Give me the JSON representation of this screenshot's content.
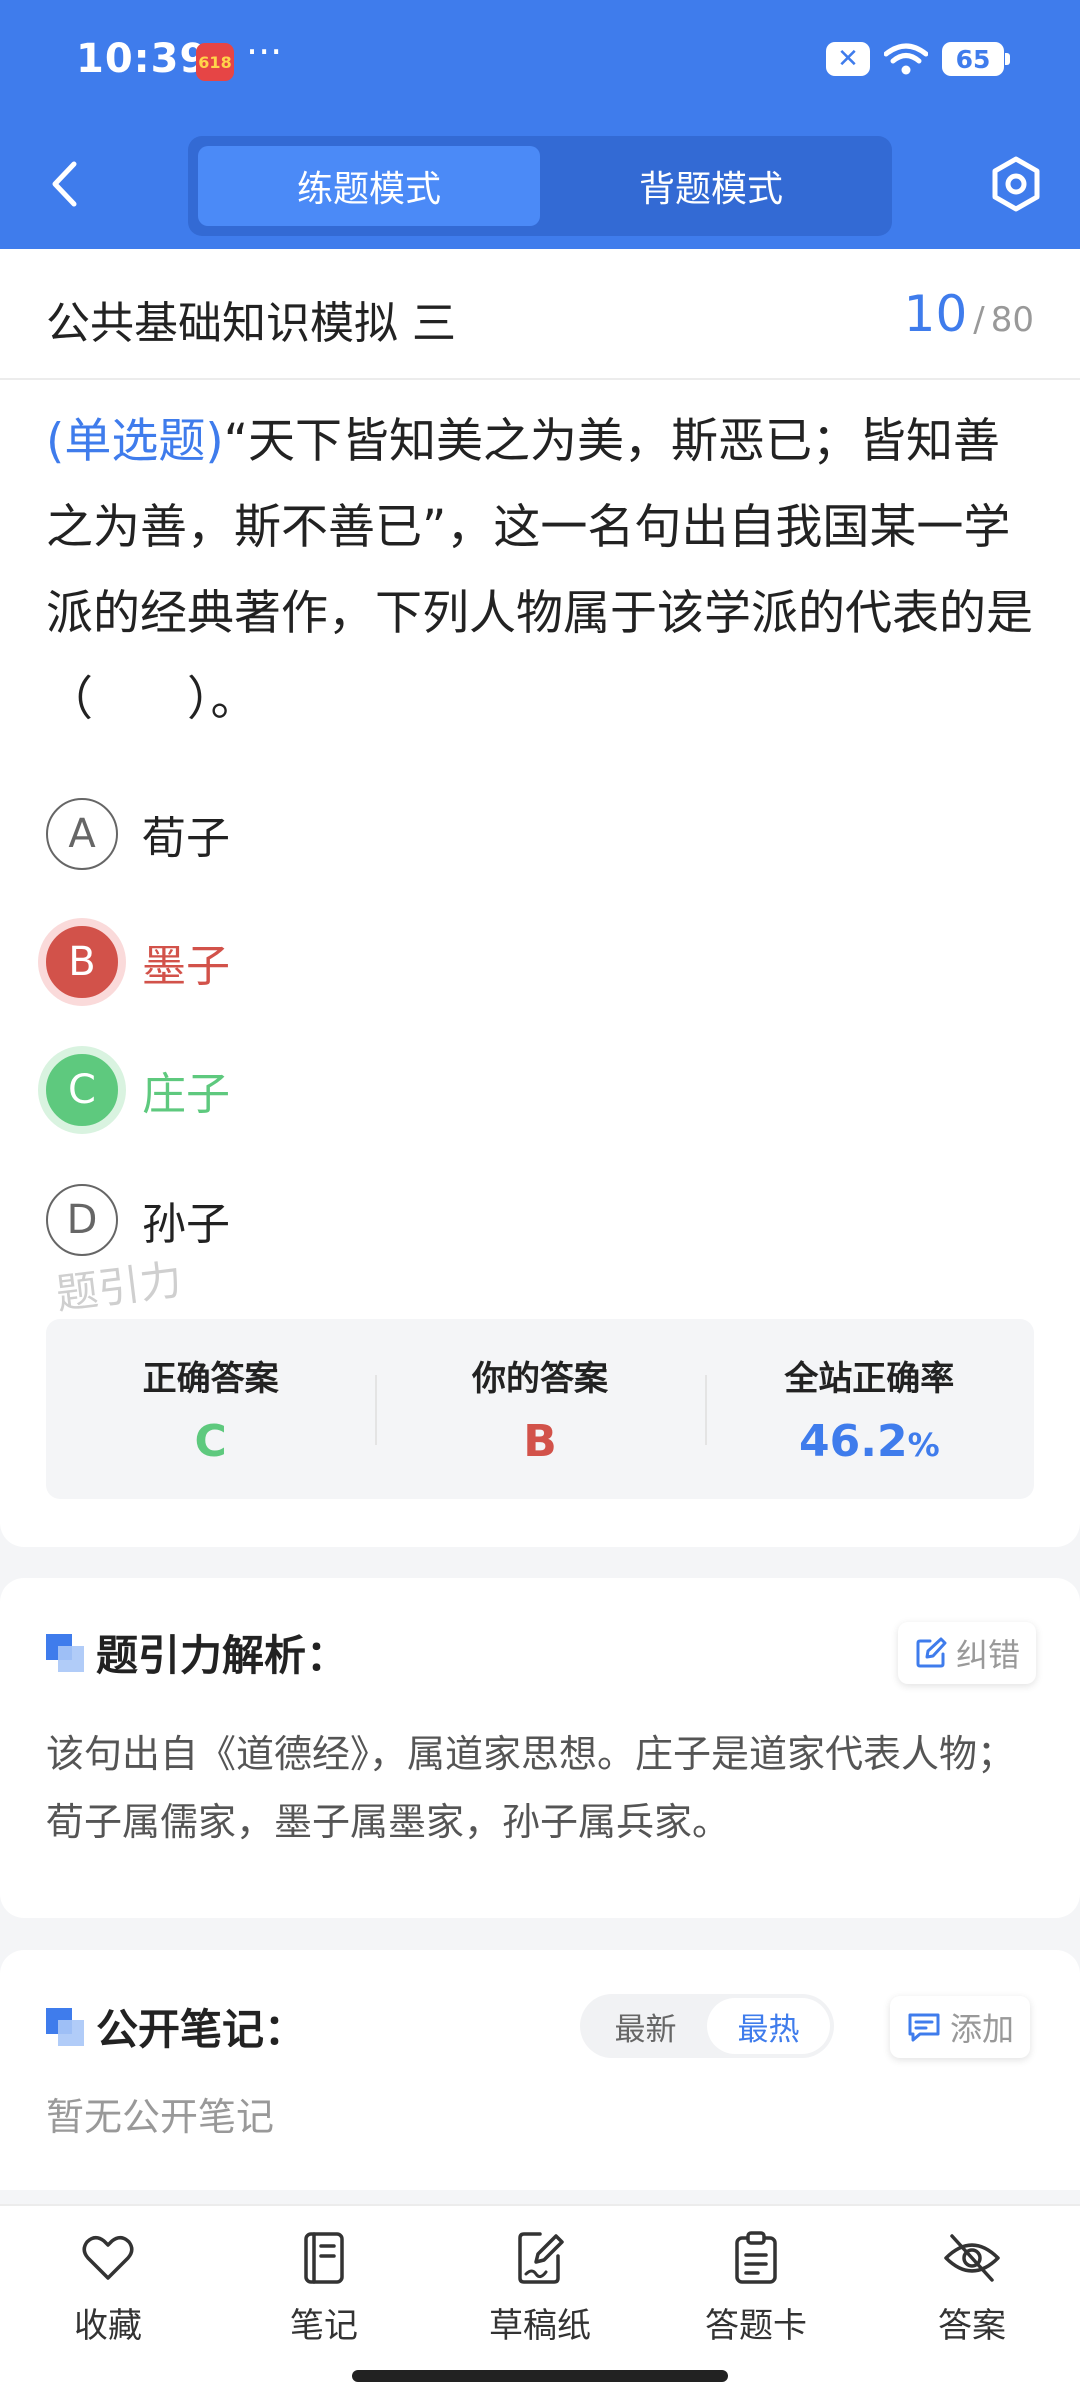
{
  "status": {
    "time": "10:39",
    "app_badge": "618",
    "dots": "···",
    "battery": "65"
  },
  "header": {
    "modes": [
      "练题模式",
      "背题模式"
    ],
    "active_mode": "练题模式"
  },
  "paper": {
    "title": "公共基础知识模拟 三",
    "current": "10",
    "separator": "/",
    "total": "80"
  },
  "question": {
    "type": "(单选题)",
    "text": "“天下皆知美之为美，斯恶已；皆知善之为善，斯不善已”，这一名句出自我国某一学派的经典著作，下列人物属于该学派的代表的是（　　）。"
  },
  "options": [
    {
      "letter": "A",
      "text": "荀子",
      "state": "normal"
    },
    {
      "letter": "B",
      "text": "墨子",
      "state": "wrong"
    },
    {
      "letter": "C",
      "text": "庄子",
      "state": "correct"
    },
    {
      "letter": "D",
      "text": "孙子",
      "state": "normal"
    }
  ],
  "watermark": "题引力",
  "answer_summary": {
    "correct_label": "正确答案",
    "correct_value": "C",
    "yours_label": "你的答案",
    "yours_value": "B",
    "rate_label": "全站正确率",
    "rate_value": "46.2",
    "rate_unit": "%"
  },
  "analysis": {
    "title": "题引力解析：",
    "report_label": "纠错",
    "text": "该句出自《道德经》，属道家思想。庄子是道家代表人物；荀子属儒家，墨子属墨家，孙子属兵家。"
  },
  "notes": {
    "title": "公开笔记：",
    "sort_options": [
      "最新",
      "最热"
    ],
    "active_sort": "最热",
    "add_label": "添加",
    "empty_text": "暂无公开笔记"
  },
  "bottom_nav": [
    {
      "label": "收藏",
      "icon": "heart-icon"
    },
    {
      "label": "笔记",
      "icon": "notebook-icon"
    },
    {
      "label": "草稿纸",
      "icon": "draft-paper-icon"
    },
    {
      "label": "答题卡",
      "icon": "answer-sheet-icon"
    },
    {
      "label": "答案",
      "icon": "eye-off-icon"
    }
  ],
  "colors": {
    "primary": "#3f7cec",
    "correct": "#5ec97e",
    "wrong": "#d2524a"
  }
}
